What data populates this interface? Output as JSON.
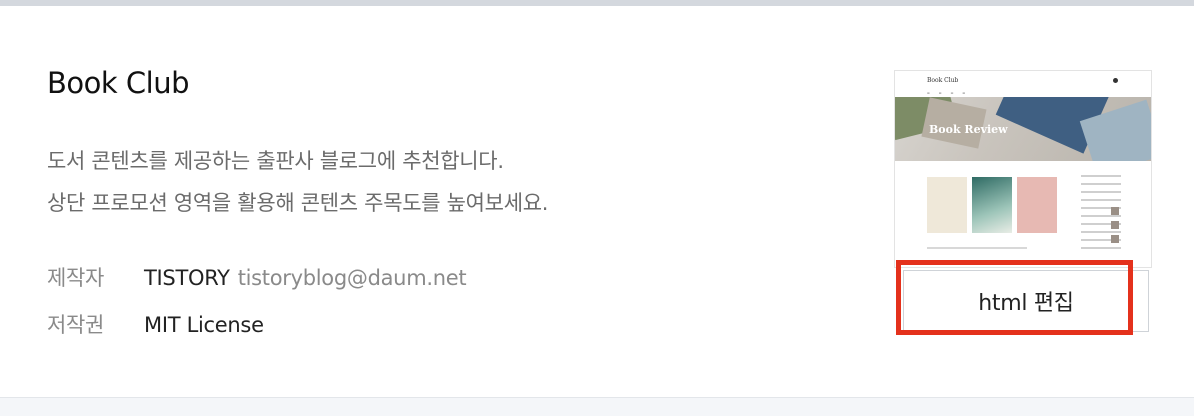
{
  "theme": {
    "title": "Book Club",
    "description": [
      "도서 콘텐츠를 제공하는 출판사 블로그에 추천합니다.",
      "상단 프로모션 영역을 활용해 콘텐츠 주목도를 높여보세요."
    ],
    "meta": {
      "author_label": "제작자",
      "author_name": "TISTORY",
      "author_email": "tistoryblog@daum.net",
      "license_label": "저작권",
      "license_value": "MIT License"
    }
  },
  "preview": {
    "logo": "Book Club",
    "hero_text": "Book Review"
  },
  "actions": {
    "edit_html_label": "html 편집"
  },
  "colors": {
    "highlight": "#e4311c"
  }
}
